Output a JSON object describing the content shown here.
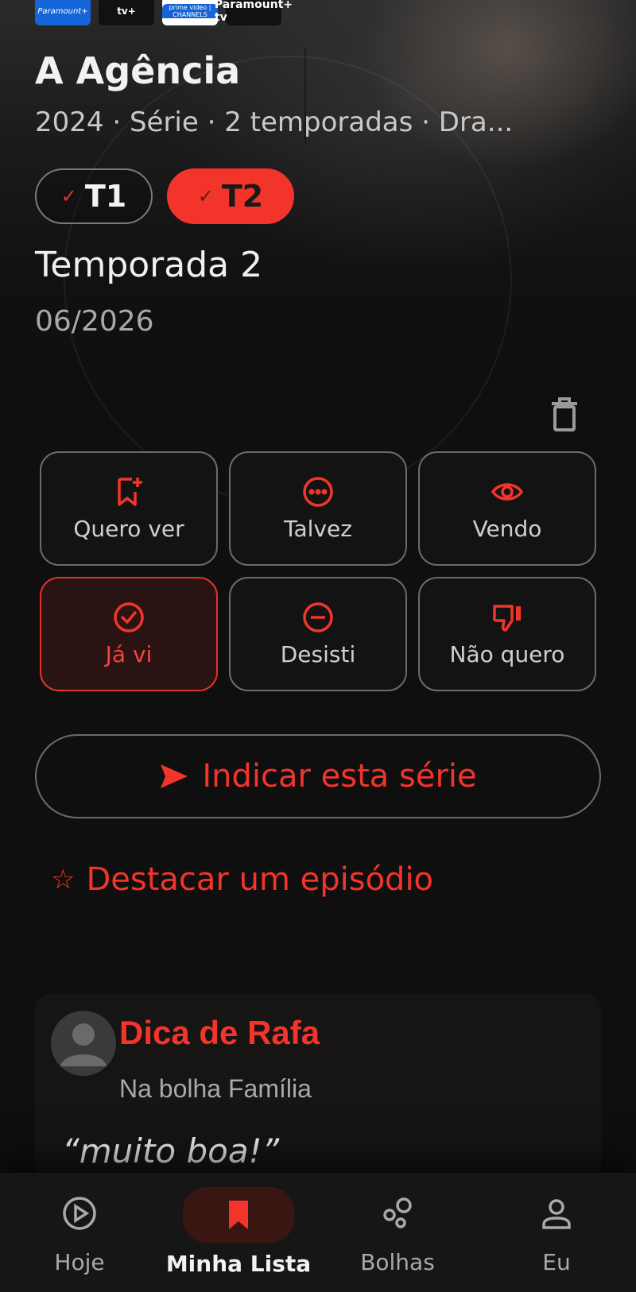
{
  "providers": [
    "Paramount+",
    "tv+",
    "prime video | CHANNELS",
    "Paramount+ tv"
  ],
  "show": {
    "title": "A Agência",
    "meta": "2024 · Série · 2 temporadas · Dra..."
  },
  "seasons": [
    {
      "label": "T1",
      "selected": false
    },
    {
      "label": "T2",
      "selected": true
    }
  ],
  "season_detail": {
    "title": "Temporada 2",
    "date": "06/2026"
  },
  "statuses": [
    {
      "label": "Quero ver",
      "icon": "bookmark-plus-icon"
    },
    {
      "label": "Talvez",
      "icon": "more-circle-icon"
    },
    {
      "label": "Vendo",
      "icon": "eye-icon"
    },
    {
      "label": "Já vi",
      "icon": "check-circle-icon",
      "active": true
    },
    {
      "label": "Desisti",
      "icon": "minus-circle-icon"
    },
    {
      "label": "Não quero",
      "icon": "thumbs-down-icon"
    }
  ],
  "actions": {
    "recommend_label": "Indicar esta série",
    "highlight_label": "Destacar um episódio"
  },
  "dica": {
    "title": "Dica de Rafa",
    "subtitle": "Na bolha Família",
    "quote": "“muito boa!”"
  },
  "nav": [
    {
      "label": "Hoje",
      "icon": "play-circle-icon"
    },
    {
      "label": "Minha Lista",
      "icon": "bookmark-icon",
      "active": true
    },
    {
      "label": "Bolhas",
      "icon": "bubbles-icon"
    },
    {
      "label": "Eu",
      "icon": "user-icon"
    }
  ],
  "colors": {
    "accent": "#f3342b",
    "background": "#0f0f0f",
    "muted_text": "#a9a9a9"
  }
}
